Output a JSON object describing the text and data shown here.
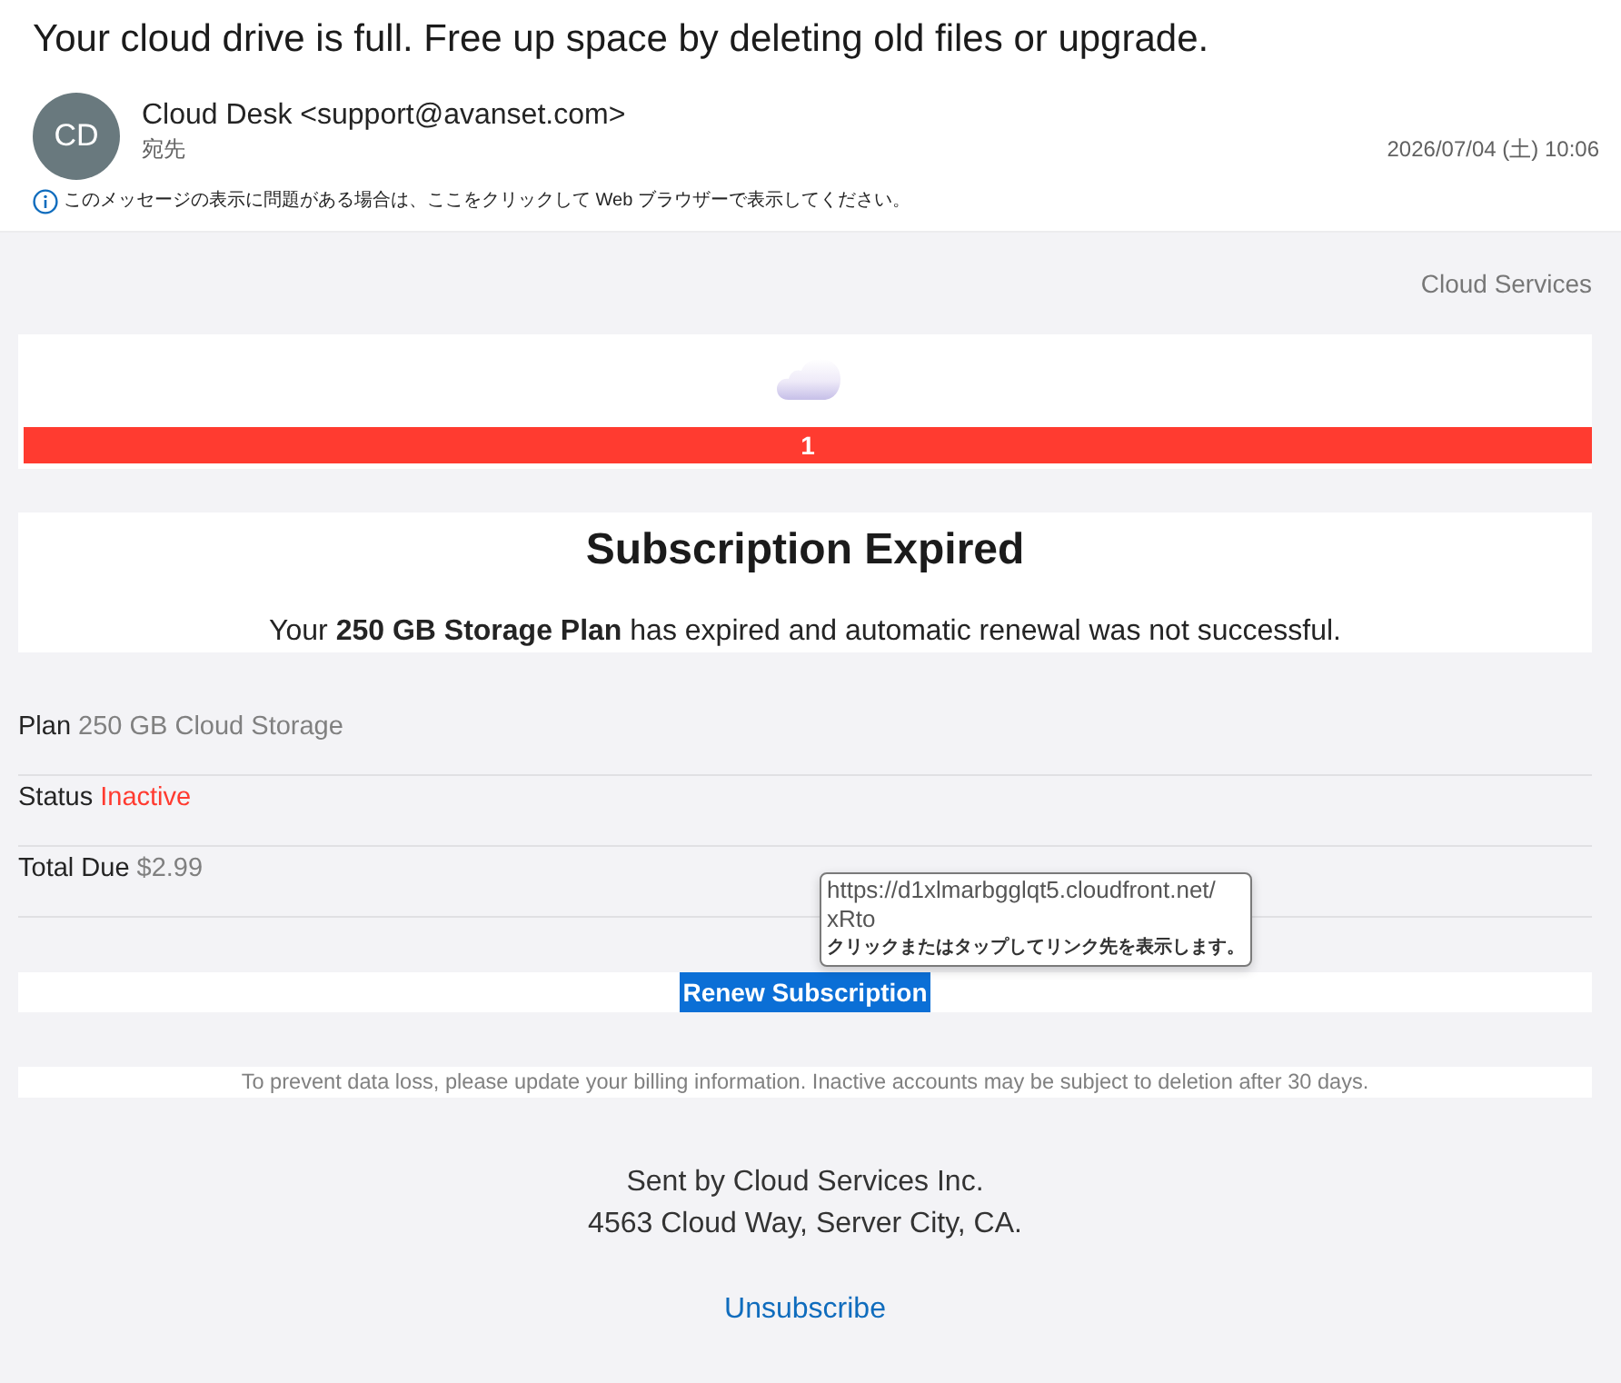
{
  "email": {
    "subject": "Your cloud drive is full. Free up space by deleting old files or upgrade.",
    "sender": {
      "initials": "CD",
      "name": "Cloud Desk <support@avanset.com>",
      "to_label": "宛先"
    },
    "date": "2026/07/04 (土) 10:06",
    "info_bar": "このメッセージの表示に問題がある場合は、ここをクリックして Web ブラウザーで表示してください。"
  },
  "message": {
    "brand": "Cloud Services",
    "banner": {
      "count": "1"
    },
    "notice": {
      "title": "Subscription Expired",
      "text": "Your **250 GB Storage Plan** has expired and automatic renewal was not successful."
    },
    "details": [
      {
        "label": "Plan",
        "value": "250 GB Cloud Storage",
        "kind": "plain"
      },
      {
        "label": "Status",
        "value": "Inactive",
        "kind": "alert"
      },
      {
        "label": "Total Due",
        "value": "$2.99",
        "kind": "plain"
      }
    ],
    "action": {
      "label": "Renew Subscription"
    },
    "tooltip": {
      "url": "https://d1xlmarbgglqt5.cloudfront.net/xRto",
      "hint": "クリックまたはタップしてリンク先を表示します。"
    },
    "note": "To prevent data loss, please update your billing information. Inactive accounts may be subject to deletion after 30 days.",
    "footer": {
      "lines": [
        "Sent by Cloud Services Inc.",
        "4563 Cloud Way, Server City, CA."
      ],
      "unsubscribe": "Unsubscribe"
    }
  }
}
